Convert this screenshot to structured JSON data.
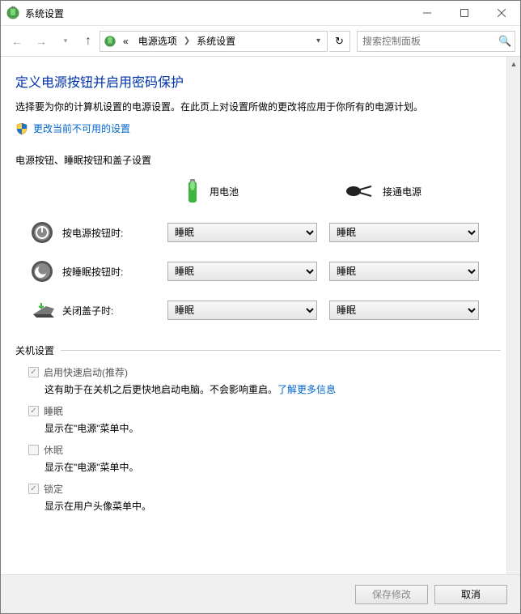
{
  "window": {
    "title": "系统设置"
  },
  "nav": {
    "crumbs": [
      "«",
      "电源选项",
      "系统设置"
    ],
    "search_placeholder": "搜索控制面板"
  },
  "page": {
    "heading": "定义电源按钮并启用密码保护",
    "desc": "选择要为你的计算机设置的电源设置。在此页上对设置所做的更改将应用于你所有的电源计划。",
    "admin_link": "更改当前不可用的设置",
    "section1": "电源按钮、睡眠按钮和盖子设置",
    "col_battery": "用电池",
    "col_ac": "接通电源",
    "rows": [
      {
        "label": "按电源按钮时:",
        "battery": "睡眠",
        "ac": "睡眠"
      },
      {
        "label": "按睡眠按钮时:",
        "battery": "睡眠",
        "ac": "睡眠"
      },
      {
        "label": "关闭盖子时:",
        "battery": "睡眠",
        "ac": "睡眠"
      }
    ],
    "section2": "关机设置",
    "shutdown_items": [
      {
        "label": "启用快速启动(推荐)",
        "checked": true,
        "sub": "这有助于在关机之后更快地启动电脑。不会影响重启。",
        "link": "了解更多信息"
      },
      {
        "label": "睡眠",
        "checked": true,
        "sub": "显示在\"电源\"菜单中。"
      },
      {
        "label": "休眠",
        "checked": false,
        "sub": "显示在\"电源\"菜单中。"
      },
      {
        "label": "锁定",
        "checked": true,
        "sub": "显示在用户头像菜单中。"
      }
    ]
  },
  "buttons": {
    "save": "保存修改",
    "cancel": "取消"
  }
}
